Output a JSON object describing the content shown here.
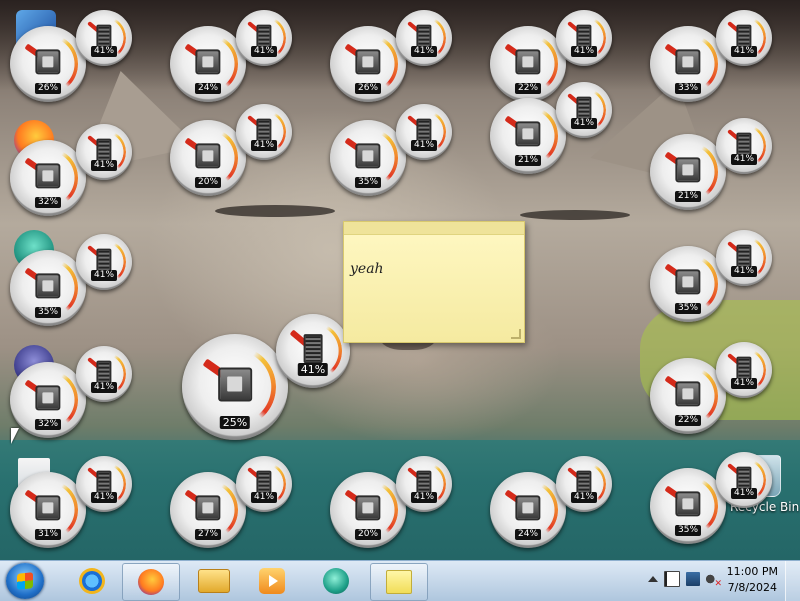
{
  "desktop": {
    "recycle_bin_label": "Recycle Bin"
  },
  "sticky_note": {
    "text": "yeah"
  },
  "gadgets": [
    {
      "cpu": "26%",
      "mem": "41%"
    },
    {
      "cpu": "24%",
      "mem": "41%"
    },
    {
      "cpu": "26%",
      "mem": "41%"
    },
    {
      "cpu": "22%",
      "mem": "41%"
    },
    {
      "cpu": "33%",
      "mem": "41%"
    },
    {
      "cpu": "32%",
      "mem": "41%"
    },
    {
      "cpu": "20%",
      "mem": "41%"
    },
    {
      "cpu": "35%",
      "mem": "41%"
    },
    {
      "cpu": "21%",
      "mem": "41%"
    },
    {
      "cpu": "21%",
      "mem": "41%"
    },
    {
      "cpu": "35%",
      "mem": "41%"
    },
    {
      "cpu": "35%",
      "mem": "41%"
    },
    {
      "cpu": "32%",
      "mem": "41%"
    },
    {
      "cpu": "25%",
      "mem": "41%"
    },
    {
      "cpu": "22%",
      "mem": "41%"
    },
    {
      "cpu": "31%",
      "mem": "41%"
    },
    {
      "cpu": "27%",
      "mem": "41%"
    },
    {
      "cpu": "20%",
      "mem": "41%"
    },
    {
      "cpu": "24%",
      "mem": "41%"
    },
    {
      "cpu": "35%",
      "mem": "41%"
    }
  ],
  "taskbar": {
    "start_icon": "windows-logo-icon",
    "pinned": [
      "internet-explorer-icon",
      "firefox-icon",
      "windows-explorer-icon",
      "media-player-icon",
      "media-center-icon",
      "sticky-notes-icon"
    ],
    "tray_icons": [
      "show-hidden-icons-icon",
      "action-center-flag-icon",
      "network-icon",
      "volume-muted-icon"
    ],
    "clock": {
      "time": "11:00 PM",
      "date": "7/8/2024"
    }
  }
}
